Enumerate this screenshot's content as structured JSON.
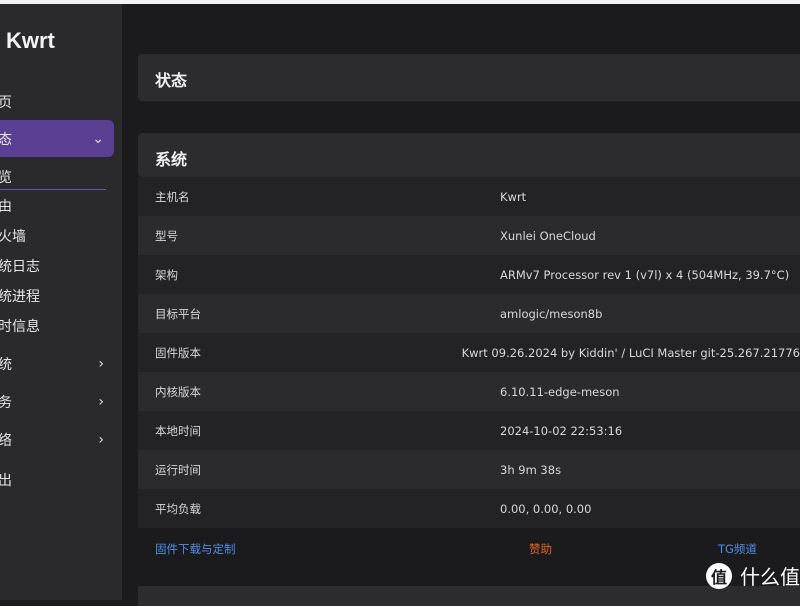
{
  "brand": {
    "name": "Kwrt"
  },
  "sidebar": {
    "items": [
      {
        "label": "页",
        "chevron": ""
      },
      {
        "label": "态",
        "chevron": "⌄"
      },
      {
        "label": "览",
        "chevron": ""
      },
      {
        "label": "由",
        "chevron": ""
      },
      {
        "label": "火墙",
        "chevron": ""
      },
      {
        "label": "统日志",
        "chevron": ""
      },
      {
        "label": "统进程",
        "chevron": ""
      },
      {
        "label": "时信息",
        "chevron": ""
      },
      {
        "label": "统",
        "chevron": "›"
      },
      {
        "label": "务",
        "chevron": "›"
      },
      {
        "label": "络",
        "chevron": "›"
      },
      {
        "label": "出",
        "chevron": ""
      }
    ]
  },
  "main": {
    "status_title": "状态",
    "system_title": "系统",
    "rows": [
      {
        "key": "主机名",
        "value": "Kwrt"
      },
      {
        "key": "型号",
        "value": "Xunlei OneCloud"
      },
      {
        "key": "架构",
        "value": "ARMv7 Processor rev 1 (v7l) x 4 (504MHz, 39.7°C)"
      },
      {
        "key": "目标平台",
        "value": "amlogic/meson8b"
      },
      {
        "key": "固件版本",
        "value": "Kwrt 09.26.2024 by Kiddin' / LuCI Master git-25.267.21776"
      },
      {
        "key": "内核版本",
        "value": "6.10.11-edge-meson"
      },
      {
        "key": "本地时间",
        "value": "2024-10-02 22:53:16"
      },
      {
        "key": "运行时间",
        "value": "3h 9m 38s"
      },
      {
        "key": "平均负载",
        "value": "0.00, 0.00, 0.00"
      }
    ],
    "links": {
      "firmware": "固件下载与定制",
      "donate": "赞助",
      "tg": "TG频道"
    }
  },
  "watermark": {
    "icon_char": "值",
    "text": "什么值"
  },
  "colors": {
    "accent": "#5b3f93",
    "link_blue": "#4f8fe6",
    "link_orange": "#e0642a"
  }
}
